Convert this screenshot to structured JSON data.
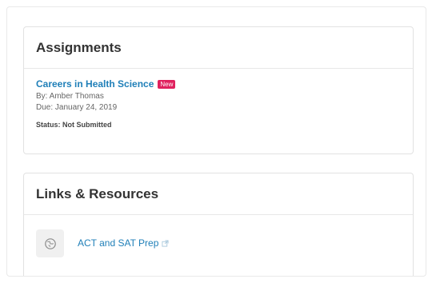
{
  "assignments": {
    "heading": "Assignments",
    "items": [
      {
        "title": "Careers in Health Science",
        "badge": "New",
        "author": "By: Amber Thomas",
        "due": "Due: January 24, 2019",
        "status": "Status: Not Submitted"
      }
    ]
  },
  "links": {
    "heading": "Links & Resources",
    "items": [
      {
        "label": "ACT and SAT Prep",
        "icon": "globe-icon",
        "link_icon": "external-link-icon"
      }
    ]
  },
  "colors": {
    "link": "#1f7fb8",
    "badge": "#e0215e",
    "heading": "#333333"
  }
}
